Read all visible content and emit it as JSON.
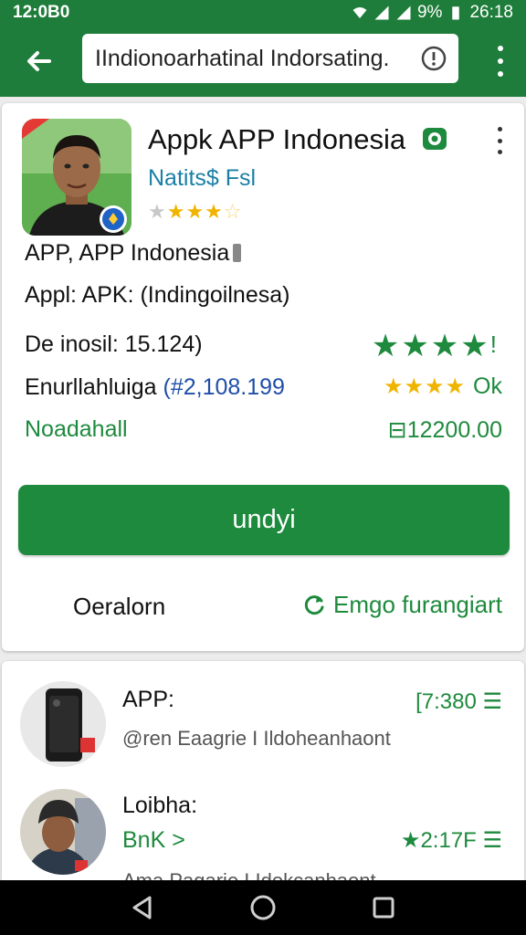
{
  "status_bar": {
    "time": "12:0B0",
    "battery": "9%",
    "clock_right": "26:18"
  },
  "toolbar": {
    "search_value": "IIndionoarhatinal Indorsating.",
    "back_icon": "arrow-back-icon",
    "info_icon": "info-icon",
    "menu_icon": "more-vert-icon"
  },
  "app": {
    "title": "Appk APP Indonesia",
    "developer": "Natits$ Fsl",
    "rating_stars": 3.5,
    "line1": "APP, APP Indonesia",
    "line2": "Appl: APK: (Indingoilnesa)",
    "downloads_label": "De inosil: 15.124)",
    "price_label": "Enurllahluiga",
    "price_value": "(#2,108.199",
    "status_label": "Noadahall",
    "rating_big": "★★★★",
    "rating_big_tail": "!",
    "rating_count": "Ok",
    "size": "⊟12200.00",
    "install_label": "undyi",
    "detail_label": "Oeralorn",
    "share_label": "Emgo furangiart"
  },
  "related": [
    {
      "title": "APP:",
      "subtitle": "@ren Eaagrie I Ildoheanhaont",
      "meta": "[7:380 ☰"
    },
    {
      "title": "Loibha:",
      "tag": "BnK >",
      "subtitle": "Ama Pagarie I Idokcanhaont",
      "meta": "★2:17F ☰"
    }
  ],
  "colors": {
    "primary": "#1e7d3a",
    "accent_green": "#1e8a3d",
    "link_blue": "#1a7fa6",
    "star_yellow": "#f0b400"
  }
}
